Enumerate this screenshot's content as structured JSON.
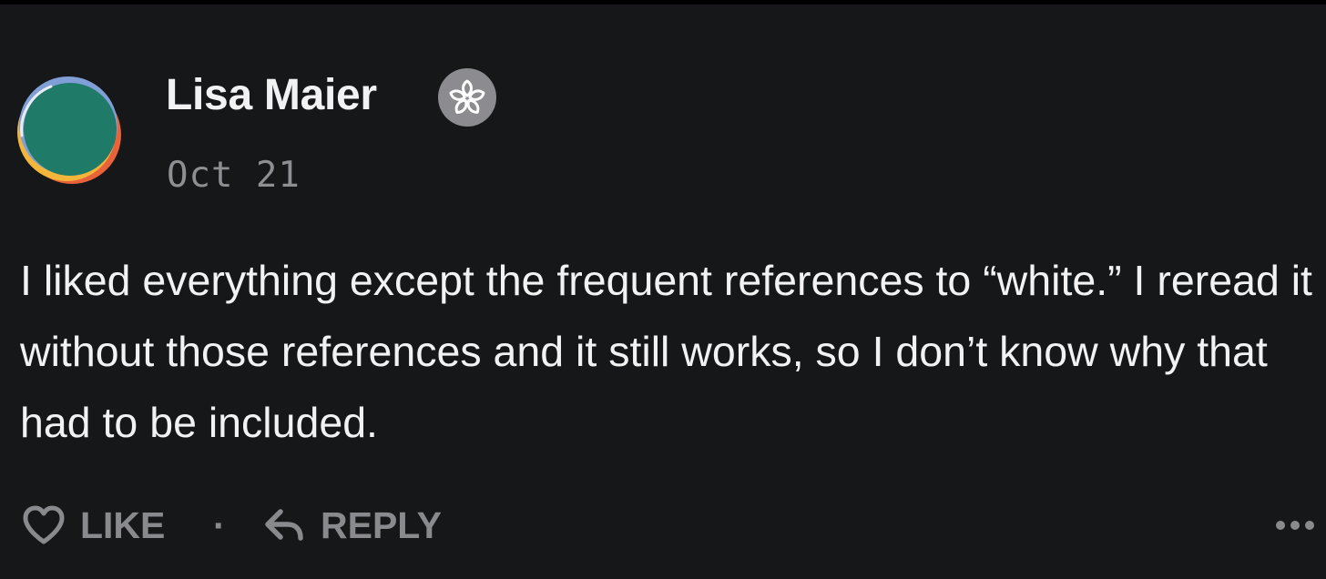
{
  "comment": {
    "author": "Lisa Maier",
    "badge_icon": "flower-badge-icon",
    "timestamp": "Oct 21",
    "text": "I liked everything except the frequent references to “white.” I reread it without those references and it still works, so I don’t know why that had to be included.",
    "avatar_colors": {
      "fill": "#1f7a67",
      "rim_top": "#7f9fd6",
      "rim_bottom_left": "#f4b63a",
      "rim_bottom_right": "#e8623a"
    }
  },
  "actions": {
    "like_label": "LIKE",
    "like_icon": "heart-outline-icon",
    "separator": "·",
    "reply_label": "REPLY",
    "reply_icon": "reply-arrow-icon",
    "more_icon": "ellipsis-icon"
  },
  "colors": {
    "background": "#161719",
    "primary_text": "#f2f2f2",
    "muted_text": "#8e8e93",
    "badge_bg": "#8c8c90"
  }
}
